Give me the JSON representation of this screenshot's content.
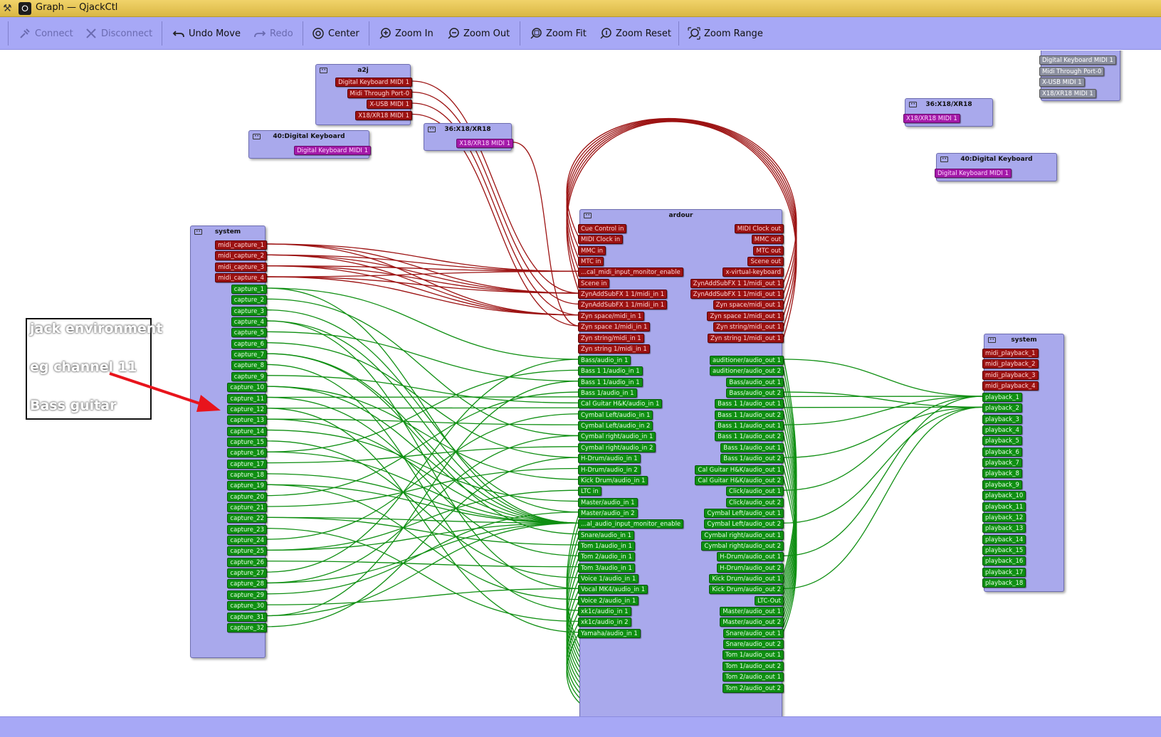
{
  "window": {
    "title": "Graph — QjackCtl"
  },
  "toolbar": {
    "connect": "Connect",
    "disconnect": "Disconnect",
    "undo_move": "Undo Move",
    "redo": "Redo",
    "center": "Center",
    "zoom_in": "Zoom In",
    "zoom_out": "Zoom Out",
    "zoom_fit": "Zoom Fit",
    "zoom_reset": "Zoom Reset",
    "zoom_range": "Zoom Range"
  },
  "annotation": {
    "line1": "jack environment",
    "line2": "eg channel 11",
    "line3": "Bass guitar"
  },
  "colors": {
    "midi": "#9c1212",
    "audio": "#0f8f12",
    "alsa": "#a41aa9",
    "node": "#a9a9ec",
    "toolbar": "#a7a8f6"
  },
  "clients": {
    "a2j": {
      "title": "a2j",
      "ports": [
        "Digital Keyboard MIDI 1",
        "Midi Through Port-0",
        "X-USB MIDI 1",
        "X18/XR18 MIDI 1"
      ]
    },
    "kbd_left": {
      "title": "40:Digital Keyboard",
      "ports": [
        "Digital Keyboard MIDI 1"
      ]
    },
    "xr18_left": {
      "title": "36:X18/XR18",
      "ports": [
        "X18/XR18 MIDI 1"
      ]
    },
    "topright": {
      "ports": [
        "Digital Keyboard MIDI 1",
        "Midi Through Port-0",
        "X-USB MIDI 1",
        "X18/XR18 MIDI 1"
      ]
    },
    "xr18_right": {
      "title": "36:X18/XR18",
      "ports": [
        "X18/XR18 MIDI 1"
      ]
    },
    "kbd_right": {
      "title": "40:Digital Keyboard",
      "ports": [
        "Digital Keyboard MIDI 1"
      ]
    },
    "system_in": {
      "title": "system",
      "midi": [
        "midi_capture_1",
        "midi_capture_2",
        "midi_capture_3",
        "midi_capture_4"
      ],
      "audio": [
        "capture_1",
        "capture_2",
        "capture_3",
        "capture_4",
        "capture_5",
        "capture_6",
        "capture_7",
        "capture_8",
        "capture_9",
        "capture_10",
        "capture_11",
        "capture_12",
        "capture_13",
        "capture_14",
        "capture_15",
        "capture_16",
        "capture_17",
        "capture_18",
        "capture_19",
        "capture_20",
        "capture_21",
        "capture_22",
        "capture_23",
        "capture_24",
        "capture_25",
        "capture_26",
        "capture_27",
        "capture_28",
        "capture_29",
        "capture_30",
        "capture_31",
        "capture_32"
      ]
    },
    "ardour": {
      "title": "ardour",
      "in_midi": [
        "Cue Control in",
        "MIDI Clock in",
        "MMC in",
        "MTC in",
        "...cal_midi_input_monitor_enable",
        "Scene in",
        "ZynAddSubFX 1 1/midi_in 1",
        "ZynAddSubFX 1 1/midi_in 1",
        "Zyn space/midi_in 1",
        "Zyn space 1/midi_in 1",
        "Zyn string/midi_in 1",
        "Zyn string 1/midi_in 1"
      ],
      "in_audio": [
        "Bass/audio_in 1",
        "Bass 1 1/audio_in 1",
        "Bass 1 1/audio_in 1",
        "Bass 1/audio_in 1",
        "Cal Guitar H&K/audio_in 1",
        "Cymbal Left/audio_in 1",
        "Cymbal Left/audio_in 2",
        "Cymbal right/audio_in 1",
        "Cymbal right/audio_in 2",
        "H-Drum/audio_in 1",
        "H-Drum/audio_in 2",
        "Kick Drum/audio_in 1",
        "LTC in",
        "Master/audio_in 1",
        "Master/audio_in 2",
        "...al_audio_input_monitor_enable",
        "Snare/audio_in 1",
        "Tom 1/audio_in 1",
        "Tom 2/audio_in 1",
        "Tom 3/audio_in 1",
        "Voice 1/audio_in 1",
        "Vocal MK4/audio_in 1",
        "Voice 2/audio_in 1",
        "xk1c/audio_in 1",
        "xk1c/audio_in 2",
        "Yamaha/audio_in 1"
      ],
      "out_midi": [
        "MIDI Clock out",
        "MMC out",
        "MTC out",
        "Scene out",
        "x-virtual-keyboard",
        "ZynAddSubFX 1 1/midi_out 1",
        "ZynAddSubFX 1 1/midi_out 1",
        "Zyn space/midi_out 1",
        "Zyn space 1/midi_out 1",
        "Zyn string/midi_out 1",
        "Zyn string 1/midi_out 1"
      ],
      "out_audio": [
        "auditioner/audio_out 1",
        "auditioner/audio_out 2",
        "Bass/audio_out 1",
        "Bass/audio_out 2",
        "Bass 1 1/audio_out 1",
        "Bass 1 1/audio_out 2",
        "Bass 1 1/audio_out 1",
        "Bass 1 1/audio_out 2",
        "Bass 1/audio_out 1",
        "Bass 1/audio_out 2",
        "Cal Guitar H&K/audio_out 1",
        "Cal Guitar H&K/audio_out 2",
        "Click/audio_out 1",
        "Click/audio_out 2",
        "Cymbal Left/audio_out 1",
        "Cymbal Left/audio_out 2",
        "Cymbal right/audio_out 1",
        "Cymbal right/audio_out 2",
        "H-Drum/audio_out 1",
        "H-Drum/audio_out 2",
        "Kick Drum/audio_out 1",
        "Kick Drum/audio_out 2",
        "LTC-Out",
        "Master/audio_out 1",
        "Master/audio_out 2",
        "Snare/audio_out 1",
        "Snare/audio_out 2",
        "Tom 1/audio_out 1",
        "Tom 1/audio_out 2",
        "Tom 2/audio_out 1",
        "Tom 2/audio_out 2"
      ]
    },
    "system_out": {
      "title": "system",
      "midi": [
        "midi_playback_1",
        "midi_playback_2",
        "midi_playback_3",
        "midi_playback_4"
      ],
      "audio": [
        "playback_1",
        "playback_2",
        "playback_3",
        "playback_4",
        "playback_5",
        "playback_6",
        "playback_7",
        "playback_8",
        "playback_9",
        "playback_10",
        "playback_11",
        "playback_12",
        "playback_13",
        "playback_14",
        "playback_15",
        "playback_16",
        "playback_17",
        "playback_18"
      ]
    }
  }
}
